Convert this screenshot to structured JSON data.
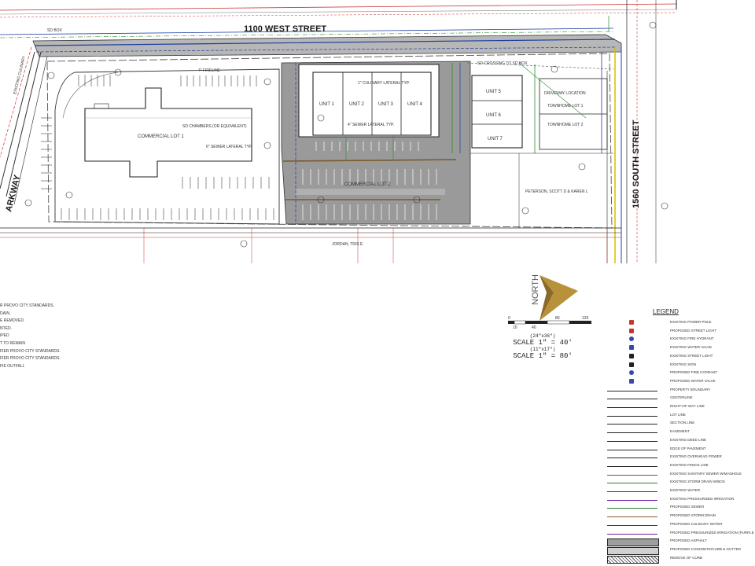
{
  "streets": {
    "north": "1100 WEST STREET",
    "east": "1560 SOUTH STREET",
    "west": "ARKWAY"
  },
  "lots": {
    "commercial_1": "COMMERCIAL LOT 1",
    "commercial_2": "COMMERCIAL LOT 2",
    "townhome_1": "TOWNHOME LOT 1",
    "townhome_2": "TOWNHOME LOT 2"
  },
  "units": [
    "UNIT 1",
    "UNIT 2",
    "UNIT 3",
    "UNIT 4",
    "UNIT 5",
    "UNIT 6",
    "UNIT 7"
  ],
  "annotations": {
    "culinary": "1\" CULINARY LATERAL TYP.",
    "sewer": "4\" SEWER LATERAL TYP.",
    "sewer_6": "6\" SEWER LATERAL TYP.",
    "storm": "SD CHAMBERS (OR EQUIVALENT)",
    "fire": "4\" FIRELINE",
    "driveway": "DRIVEWAY LOCATION",
    "sd_boxes": "SD BOX",
    "storm_drain": "SD CROSSING TO SD BOX",
    "existing_culinary": "EXISTING CULINARY",
    "neighbor_se": "PETERSON, SCOTT D & KAREN L",
    "neighbor_s": "JORDAN, TRIS E"
  },
  "notes": [
    "R PROVO CITY STANDARDS.",
    "DAIN.",
    "E REMOVED.",
    "NTED.",
    "IPED",
    "T TO REMAIN",
    "FIER PROVO CITY STANDARDS.",
    "FIER PROVO CITY STANDARDS.",
    "FIE OUTFALL"
  ],
  "north_arrow": {
    "label": "NORTH"
  },
  "scale": {
    "bar_ticks": [
      "0",
      "10",
      "40",
      "80",
      "120"
    ],
    "sheet_large": "(24\"x36\")",
    "scale_large": "SCALE 1\" = 40'",
    "sheet_small": "(11\"x17\")",
    "scale_small": "SCALE 1\" = 80'"
  },
  "legend": {
    "title": "LEGEND",
    "items": [
      {
        "label": "EXISTING POWER POLE",
        "symbol": "power-pole-icon",
        "color": "#c0392b"
      },
      {
        "label": "PROPOSED STREET LIGHT",
        "symbol": "street-light-icon",
        "color": "#c0392b"
      },
      {
        "label": "EXISTING FIRE HYDRANT",
        "symbol": "fire-hydrant-icon",
        "color": "#3949ab"
      },
      {
        "label": "EXISTING WATER VALVE",
        "symbol": "water-valve-icon",
        "color": "#3949ab"
      },
      {
        "label": "EXISTING STREET LIGHT",
        "symbol": "street-light-icon",
        "color": "#222222"
      },
      {
        "label": "EXISTING SIGN",
        "symbol": "sign-icon",
        "color": "#222222"
      },
      {
        "label": "PROPOSED FIRE HYDRANT",
        "symbol": "fire-hydrant-icon",
        "color": "#3949ab"
      },
      {
        "label": "PROPOSED WATER VALVE",
        "symbol": "water-valve-icon",
        "color": "#3949ab"
      },
      {
        "label": "PROPERTY BOUNDARY",
        "symbol": "line",
        "color": "#222222"
      },
      {
        "label": "CENTERLINE",
        "symbol": "line",
        "color": "#222222"
      },
      {
        "label": "RIGHT-OF-WAY LINE",
        "symbol": "line",
        "color": "#222222"
      },
      {
        "label": "LOT LINE",
        "symbol": "line",
        "color": "#222222"
      },
      {
        "label": "SECTION LINE",
        "symbol": "line",
        "color": "#222222"
      },
      {
        "label": "EASEMENT",
        "symbol": "line",
        "color": "#222222"
      },
      {
        "label": "EXISTING DEED LINE",
        "symbol": "line",
        "color": "#222222"
      },
      {
        "label": "EDGE OF PAVEMENT",
        "symbol": "line",
        "color": "#222222"
      },
      {
        "label": "EXISTING OVERHEAD POWER",
        "symbol": "line",
        "color": "#222222"
      },
      {
        "label": "EXISTING FENCE LINE",
        "symbol": "line",
        "color": "#222222"
      },
      {
        "label": "EXISTING SANITARY SEWER W/MANHOLE",
        "symbol": "line",
        "color": "#2e7d32"
      },
      {
        "label": "EXISTING STORM DRAIN W/BOX",
        "symbol": "line",
        "color": "#2e7d32"
      },
      {
        "label": "EXISTING WATER",
        "symbol": "line",
        "color": "#1e3a8a"
      },
      {
        "label": "EXISTING PRESSURIZED IRRIGATION",
        "symbol": "line",
        "color": "#6a1b9a"
      },
      {
        "label": "PROPOSED SEWER",
        "symbol": "line",
        "color": "#2e7d32"
      },
      {
        "label": "PROPOSED STORM DRAIN",
        "symbol": "line",
        "color": "#8b5a2b"
      },
      {
        "label": "PROPOSED CULINARY WATER",
        "symbol": "line",
        "color": "#1e3a8a"
      },
      {
        "label": "PROPOSED PRESSURIZED IRRIGATION (PURPLE PVC)",
        "symbol": "line",
        "color": "#6a1b9a"
      },
      {
        "label": "PROPOSED ASPHALT",
        "symbol": "fill-gray",
        "color": "#9e9e9e"
      },
      {
        "label": "PROPOSED CONCRETE/CURB & GUTTER",
        "symbol": "fill-light",
        "color": "#d0d0d0"
      },
      {
        "label": "REMOVE OF CURB",
        "symbol": "fill-hatch",
        "color": "#555555"
      }
    ]
  },
  "colors": {
    "asphalt": "#9a9a9a",
    "road": "#b7b7b7",
    "storm": "#7a5a2a",
    "water": "#1f3fa0",
    "sewer": "#2e8b2e",
    "power": "#cc3333",
    "gas": "#d4c000",
    "north_arrow": "#b8923a"
  }
}
